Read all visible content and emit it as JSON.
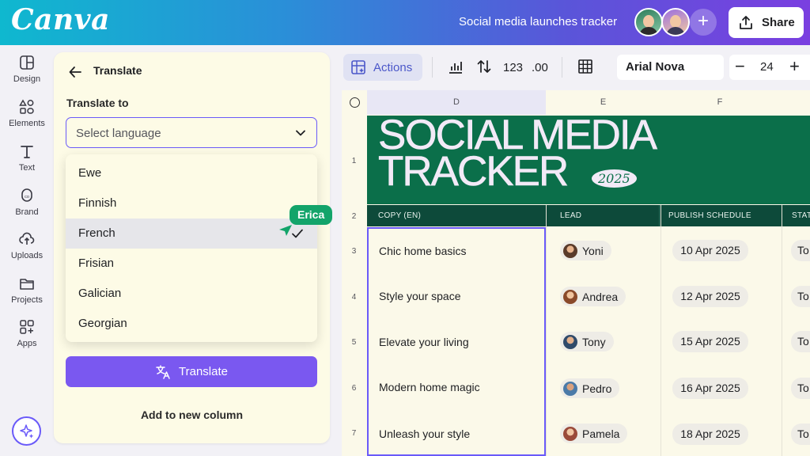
{
  "app": {
    "logo": "Canva",
    "doc_title": "Social media launches tracker",
    "share_label": "Share",
    "add_collab": "+"
  },
  "rail": {
    "items": [
      {
        "label": "Design",
        "icon": "design-icon"
      },
      {
        "label": "Elements",
        "icon": "elements-icon"
      },
      {
        "label": "Text",
        "icon": "text-icon"
      },
      {
        "label": "Brand",
        "icon": "brand-icon"
      },
      {
        "label": "Uploads",
        "icon": "uploads-icon"
      },
      {
        "label": "Projects",
        "icon": "projects-icon"
      },
      {
        "label": "Apps",
        "icon": "apps-icon"
      }
    ]
  },
  "panel": {
    "title": "Translate",
    "translate_to": "Translate to",
    "select_placeholder": "Select language",
    "options": [
      "Ewe",
      "Finnish",
      "French",
      "Frisian",
      "Galician",
      "Georgian"
    ],
    "selected": "French",
    "translate_button": "Translate",
    "add_column": "Add to new column"
  },
  "collaborator": {
    "name": "Erica",
    "color": "#13a46a"
  },
  "toolbar": {
    "actions": "Actions",
    "number_format": "123",
    "decimal": ".00",
    "font": "Arial Nova",
    "font_size": "24",
    "minus": "−",
    "plus": "+"
  },
  "sheet": {
    "columns": [
      "D",
      "E",
      "F"
    ],
    "row_numbers": [
      "1",
      "2",
      "3",
      "4",
      "5",
      "6",
      "7"
    ],
    "banner_title_line1": "SOCIAL MEDIA",
    "banner_title_line2": "TRACKER",
    "banner_year": "2025",
    "headers": [
      "COPY (EN)",
      "LEAD",
      "PUBLISH SCHEDULE",
      "STAT"
    ],
    "rows": [
      {
        "copy": "Chic home basics",
        "lead": "Yoni",
        "date": "10 Apr 2025",
        "status": "To"
      },
      {
        "copy": "Style your space",
        "lead": "Andrea",
        "date": "12 Apr 2025",
        "status": "To"
      },
      {
        "copy": "Elevate your living",
        "lead": "Tony",
        "date": "15 Apr 2025",
        "status": "To"
      },
      {
        "copy": "Modern home magic",
        "lead": "Pedro",
        "date": "16 Apr 2025",
        "status": "To"
      },
      {
        "copy": "Unleash your style",
        "lead": "Pamela",
        "date": "18 Apr 2025",
        "status": "To"
      }
    ]
  },
  "colors": {
    "accent": "#6a5af9",
    "translate_button": "#7a58f0",
    "banner": "#0b6f4a",
    "header_row": "#0d4a3a"
  }
}
